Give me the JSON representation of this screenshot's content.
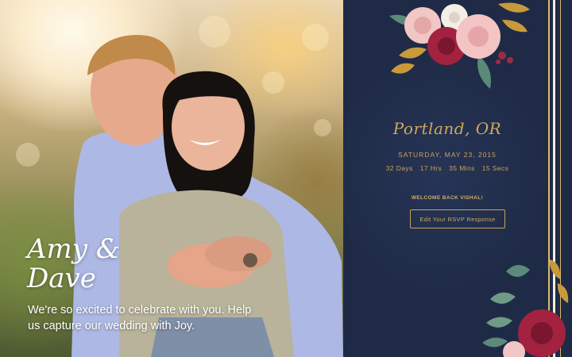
{
  "hero": {
    "names_line1": "Amy &",
    "names_line2": "Dave",
    "tagline": "We're so excited to celebrate with you. Help us capture our wedding with Joy."
  },
  "event": {
    "city": "Portland, OR",
    "date": "SATURDAY, MAY 23, 2015",
    "countdown": {
      "days": "32 Days",
      "hours": "17 Hrs",
      "minutes": "35 Mins",
      "seconds": "15 Secs"
    }
  },
  "rsvp": {
    "welcome": "WELCOME BACK VISHAL!",
    "button_label": "Edit Your RSVP Response"
  },
  "colors": {
    "panel_background": "#1f2b46",
    "gold_accent": "#cfa860",
    "hero_text": "#ffffff"
  },
  "icons": [
    "floral-bouquet-top",
    "floral-bouquet-bottom"
  ]
}
